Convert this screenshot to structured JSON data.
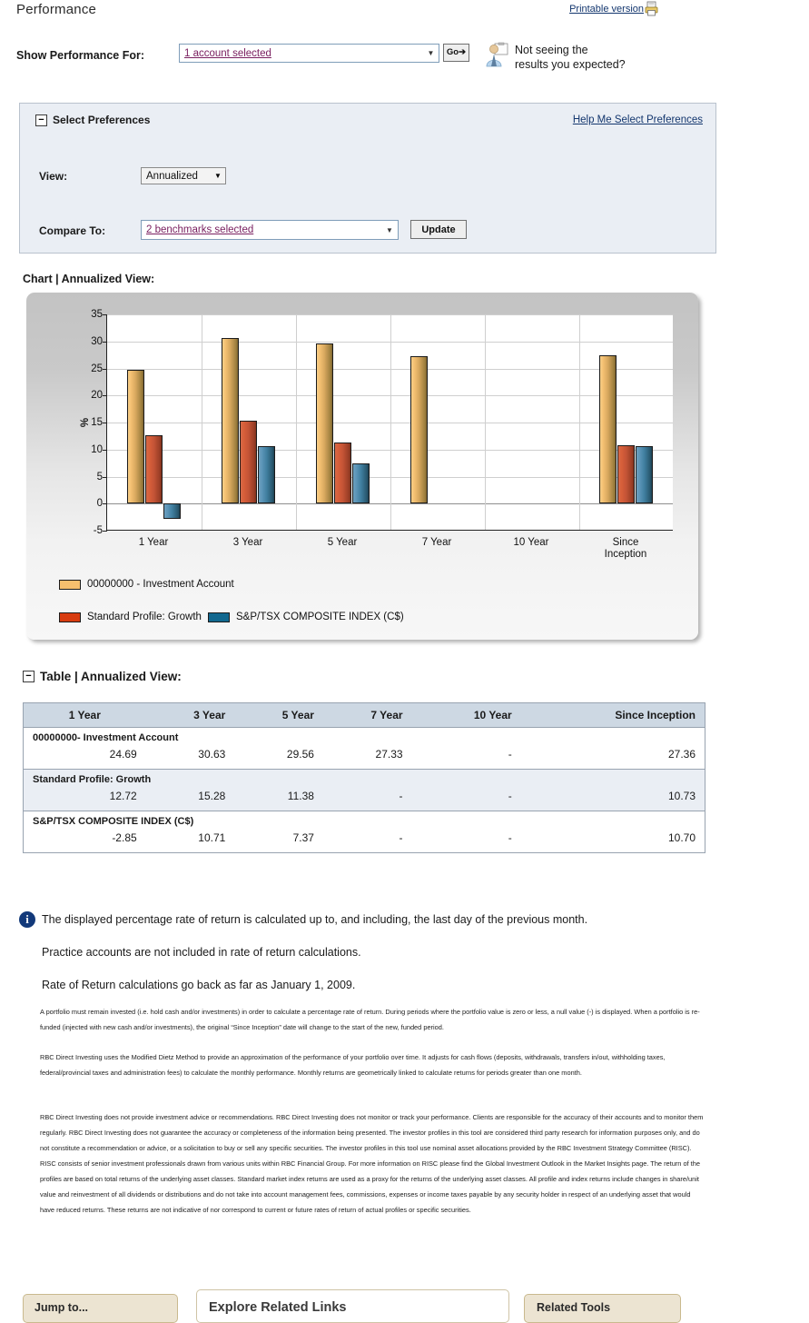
{
  "header": {
    "title": "Performance",
    "printable_label": "Printable version",
    "printer_icon": "printer-icon"
  },
  "toolbar": {
    "show_performance_label": "Show Performance For:",
    "account_select_value": "1 account selected",
    "go_label": "Go➔",
    "avatar_icon": "person-presenter-icon",
    "not_seeing_line1": "Not seeing the",
    "not_seeing_line2": "results you expected?"
  },
  "preferences": {
    "collapse_glyph": "−",
    "title": "Select Preferences",
    "help_link": "Help Me Select Preferences",
    "view_label": "View:",
    "view_value": "Annualized",
    "compare_label": "Compare To:",
    "compare_value": "2 benchmarks selected",
    "update_label": "Update",
    "dropdown_glyph": "▼"
  },
  "chart_section": {
    "heading": "Chart | Annualized View:"
  },
  "table_section": {
    "collapse_glyph": "−",
    "heading": "Table | Annualized View:",
    "columns": [
      "1 Year",
      "3 Year",
      "5 Year",
      "7 Year",
      "10 Year",
      "Since Inception"
    ],
    "rows": [
      {
        "name": "00000000- Investment Account",
        "values": [
          "24.69",
          "30.63",
          "29.56",
          "27.33",
          "-",
          "27.36"
        ]
      },
      {
        "name": "Standard Profile: Growth",
        "values": [
          "12.72",
          "15.28",
          "11.38",
          "-",
          "-",
          "10.73"
        ]
      },
      {
        "name": "S&P/TSX COMPOSITE INDEX (C$)",
        "values": [
          "-2.85",
          "10.71",
          "7.37",
          "-",
          "-",
          "10.70"
        ]
      }
    ]
  },
  "disclaimer": {
    "info_glyph": "i",
    "note1": "The displayed percentage rate of return is calculated up to, and including, the last day of the previous month.",
    "note2": "Practice accounts are not included in rate of return calculations.",
    "note3": "Rate of Return calculations go back as far as January 1, 2009.",
    "para1": "A portfolio must remain invested (i.e. hold cash and/or investments) in order to calculate a percentage rate of return. During periods where the portfolio value is zero or less, a null value (-) is displayed. When a portfolio is re-funded (injected with new cash and/or investments), the original “Since Inception” date will change to the start of the new, funded period.",
    "para2": "RBC Direct Investing uses the Modified Dietz Method to provide an approximation of the performance of your portfolio over time. It adjusts for cash flows (deposits, withdrawals, transfers in/out, withholding taxes, federal/provincial taxes and administration fees) to calculate the monthly performance. Monthly returns are geometrically linked to calculate returns for periods greater than one month.",
    "para3": "RBC Direct Investing does not provide investment advice or recommendations. RBC Direct Investing does not monitor or track your performance. Clients are responsible for the accuracy of their accounts and to monitor them regularly. RBC Direct Investing does not guarantee the accuracy or completeness of the information being presented. The investor profiles in this tool are considered third party research for information purposes only, and do not constitute a recommendation or advice, or a solicitation to buy or sell any specific securities. The investor profiles in this tool use nominal asset allocations provided by the RBC Investment Strategy Committee (RISC). RISC consists of senior investment professionals drawn from various units within RBC Financial Group. For more information on RISC please find the Global Investment Outlook in the Market Insights page. The return of the profiles are based on total returns of the underlying asset classes. Standard market index returns are used as a proxy for the returns of the underlying asset classes. All profile and index returns include changes in share/unit value and reinvestment of all dividends or distributions and do not take into account management fees, commissions, expenses or income taxes payable by any security holder in respect of an underlying asset that would have reduced returns. These returns are not indicative of nor correspond to current or future rates of return of actual profiles or specific securities."
  },
  "footer": {
    "jump_to": "Jump to...",
    "explore_related_links": "Explore Related Links",
    "related_tools": "Related Tools"
  },
  "chart_data": {
    "type": "bar",
    "title": "Chart | Annualized View:",
    "xlabel": "",
    "ylabel": "%",
    "ylim": [
      -5,
      35
    ],
    "yticks": [
      -5,
      0,
      5,
      10,
      15,
      20,
      25,
      30,
      35
    ],
    "grid": true,
    "legend_position": "bottom-left",
    "categories": [
      "1 Year",
      "3 Year",
      "5 Year",
      "7 Year",
      "10 Year",
      "Since Inception"
    ],
    "series": [
      {
        "name": "00000000 - Investment Account",
        "color": "#f6bf6e",
        "values": [
          24.69,
          30.63,
          29.56,
          27.33,
          null,
          27.36
        ]
      },
      {
        "name": "Standard Profile: Growth",
        "color": "#d83c10",
        "values": [
          12.72,
          15.28,
          11.38,
          null,
          null,
          10.73
        ]
      },
      {
        "name": "S&P/TSX COMPOSITE INDEX (C$)",
        "color": "#12688f",
        "values": [
          -2.85,
          10.71,
          7.37,
          null,
          null,
          10.7
        ]
      }
    ]
  }
}
